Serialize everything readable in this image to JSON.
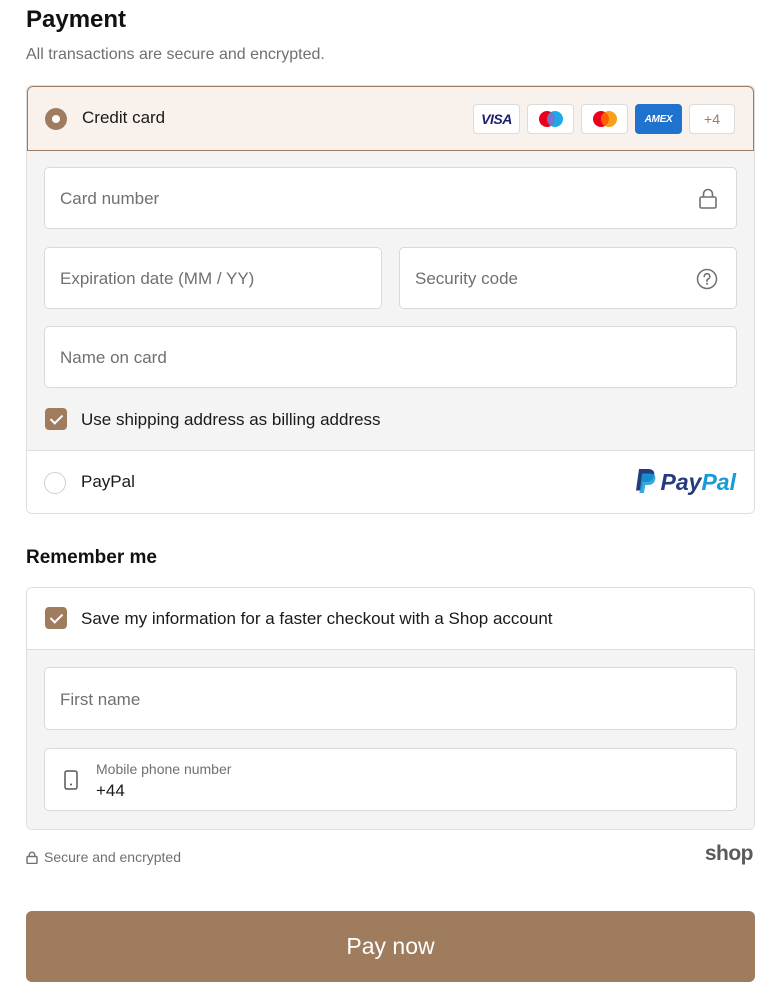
{
  "payment": {
    "title": "Payment",
    "subtitle": "All transactions are secure and encrypted.",
    "credit_card": {
      "label": "Credit card",
      "selected": true,
      "brands": [
        "VISA",
        "Maestro",
        "Mastercard",
        "AMEX"
      ],
      "more_brands": "+4",
      "fields": {
        "card_number": "Card number",
        "expiration": "Expiration date (MM / YY)",
        "security_code": "Security code",
        "name_on_card": "Name on card"
      },
      "billing_checkbox_label": "Use shipping address as billing address",
      "billing_checked": true
    },
    "paypal": {
      "label": "PayPal",
      "logo_text_1": "Pay",
      "logo_text_2": "Pal",
      "selected": false
    }
  },
  "remember": {
    "title": "Remember me",
    "save_label": "Save my information for a faster checkout with a Shop account",
    "save_checked": true,
    "first_name_placeholder": "First name",
    "phone_label": "Mobile phone number",
    "phone_value": "+44"
  },
  "footer": {
    "secure_text": "Secure and encrypted",
    "shop_logo": "shop",
    "pay_button": "Pay now"
  },
  "colors": {
    "accent": "#a07c5f",
    "accent_bg": "#f8f1ec",
    "paypal_dark": "#253b80",
    "paypal_light": "#179bd7",
    "amex": "#1f72cd",
    "visa": "#1a1f71"
  }
}
